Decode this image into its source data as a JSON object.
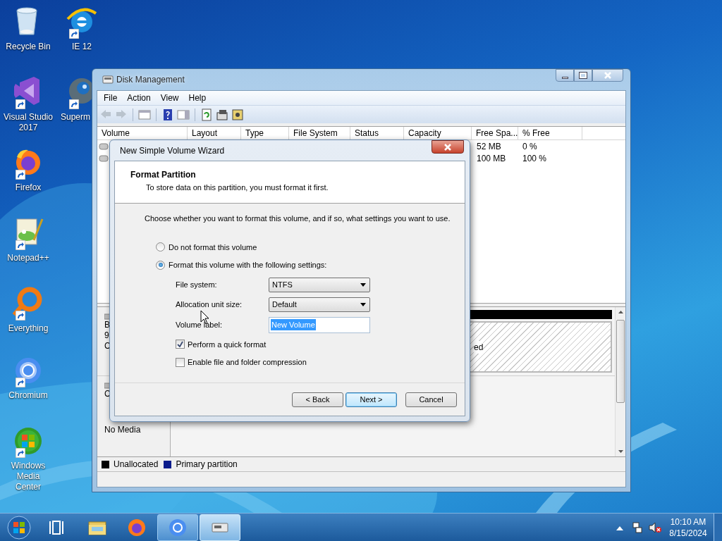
{
  "desktop_icons": [
    {
      "label": "Recycle Bin",
      "shortcut": false
    },
    {
      "label": "IE 12",
      "shortcut": true
    },
    {
      "label": "Visual Studio 2017",
      "shortcut": true
    },
    {
      "label": "Superm",
      "shortcut": true
    },
    {
      "label": "Firefox",
      "shortcut": true
    },
    {
      "label": "Notepad++",
      "shortcut": true
    },
    {
      "label": "Everything",
      "shortcut": true
    },
    {
      "label": "Chromium",
      "shortcut": true
    },
    {
      "label": "Windows Media Center",
      "shortcut": true
    }
  ],
  "disk_management": {
    "title": "Disk Management",
    "menu": [
      "File",
      "Action",
      "View",
      "Help"
    ],
    "columns": [
      "Volume",
      "Layout",
      "Type",
      "File System",
      "Status",
      "Capacity",
      "Free Spa...",
      "% Free"
    ],
    "rows": [
      {
        "free_space": "52 MB",
        "percent_free": "0 %"
      },
      {
        "free_space": "100 MB",
        "percent_free": "100 %"
      }
    ],
    "disks": [
      {
        "labels": [
          "B",
          "9",
          "C"
        ],
        "partition_text": "ed"
      },
      {
        "labels": [
          "C",
          "No Media"
        ]
      }
    ],
    "legend": [
      {
        "label": "Unallocated",
        "color": "#000000"
      },
      {
        "label": "Primary partition",
        "color": "#0b1c8c"
      }
    ]
  },
  "wizard": {
    "title": "New Simple Volume Wizard",
    "heading": "Format Partition",
    "subheading": "To store data on this partition, you must format it first.",
    "instruction": "Choose whether you want to format this volume, and if so, what settings you want to use.",
    "options": [
      {
        "label": "Do not format this volume",
        "selected": false
      },
      {
        "label": "Format this volume with the following settings:",
        "selected": true
      }
    ],
    "fields": [
      {
        "kind": "dropdown",
        "label": "File system:",
        "value": "NTFS"
      },
      {
        "kind": "dropdown",
        "label": "Allocation unit size:",
        "value": "Default"
      },
      {
        "kind": "text",
        "label": "Volume label:",
        "value": "New Volume"
      }
    ],
    "checkboxes": [
      {
        "label": "Perform a quick format",
        "checked": true
      },
      {
        "label": "Enable file and folder compression",
        "checked": false
      }
    ],
    "buttons": [
      {
        "label": "< Back",
        "default": false
      },
      {
        "label": "Next >",
        "default": true
      },
      {
        "label": "Cancel",
        "default": false
      }
    ]
  },
  "taskbar": {
    "apps": [
      {
        "running": false,
        "active": false
      },
      {
        "running": false,
        "active": false
      },
      {
        "running": false,
        "active": false
      },
      {
        "running": true,
        "active": false
      },
      {
        "running": true,
        "active": true
      }
    ],
    "volume_muted": true,
    "time": "10:10 AM",
    "date": "8/15/2024"
  }
}
